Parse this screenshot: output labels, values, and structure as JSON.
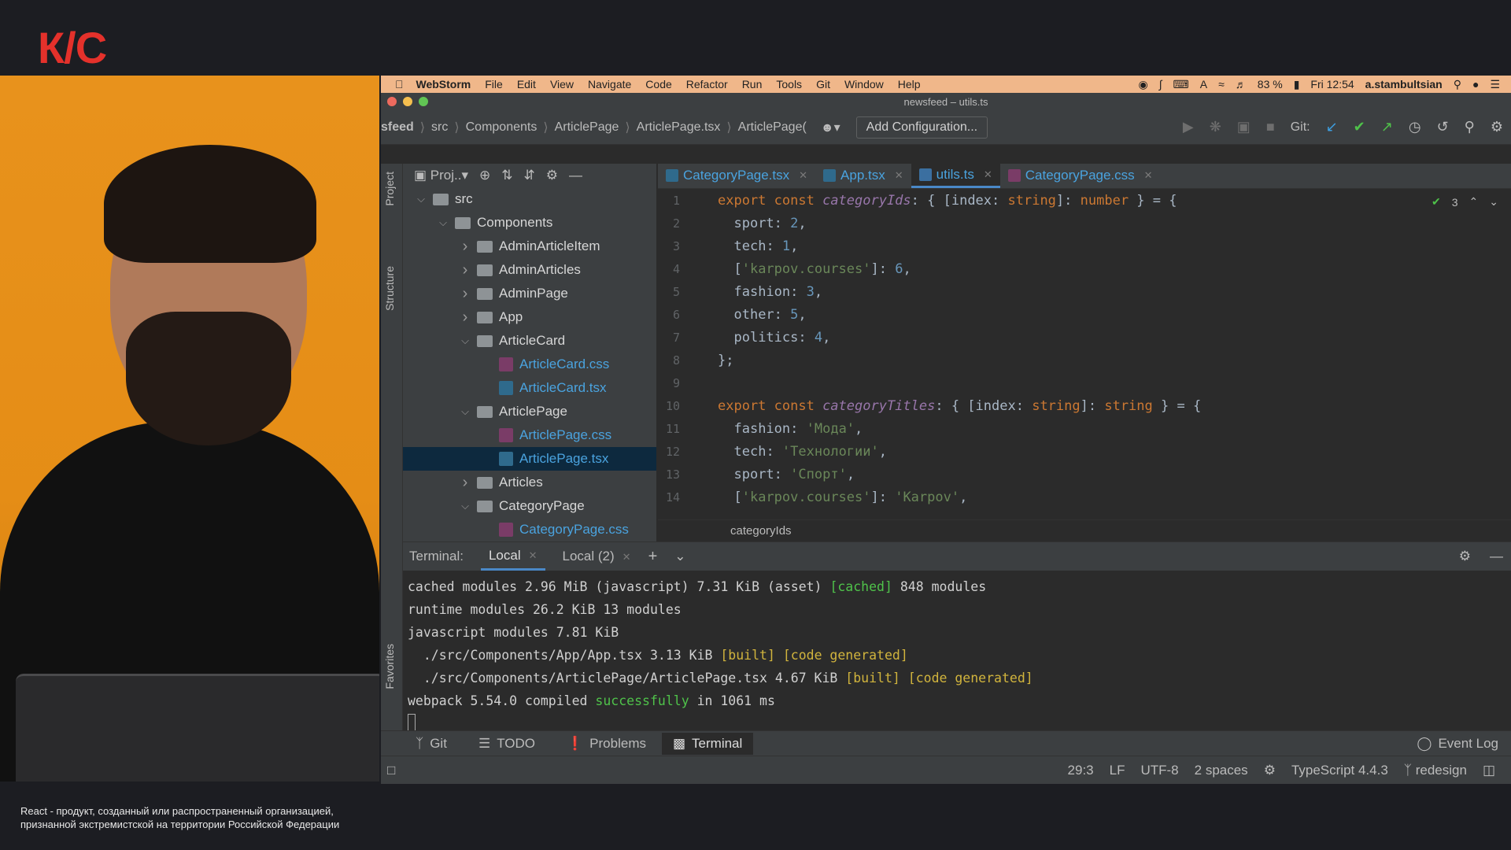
{
  "overlay": {
    "logo": "К/С",
    "disclaimer_line1": "React - продукт, созданный или распространенный организацией,",
    "disclaimer_line2": "признанной экстремистской на территории Российской Федерации"
  },
  "menubar": {
    "app": "WebStorm",
    "items": [
      "File",
      "Edit",
      "View",
      "Navigate",
      "Code",
      "Refactor",
      "Run",
      "Tools",
      "Git",
      "Window",
      "Help"
    ],
    "battery": "83 %",
    "clock": "Fri 12:54",
    "user": "a.stambultsian"
  },
  "window": {
    "title": "newsfeed – utils.ts"
  },
  "navbar": {
    "crumbs": [
      "sfeed",
      "src",
      "Components",
      "ArticlePage",
      "ArticlePage.tsx",
      "ArticlePage("
    ],
    "add_config": "Add Configuration...",
    "git_label": "Git:"
  },
  "side": {
    "project": "Project",
    "structure": "Structure",
    "favorites": "Favorites"
  },
  "project": {
    "header": "Proj..",
    "tree": [
      {
        "label": "src",
        "type": "folder",
        "level": 0,
        "open": true
      },
      {
        "label": "Components",
        "type": "folder",
        "level": 1,
        "open": true
      },
      {
        "label": "AdminArticleItem",
        "type": "folder",
        "level": 2,
        "open": false
      },
      {
        "label": "AdminArticles",
        "type": "folder",
        "level": 2,
        "open": false
      },
      {
        "label": "AdminPage",
        "type": "folder",
        "level": 2,
        "open": false
      },
      {
        "label": "App",
        "type": "folder",
        "level": 2,
        "open": false
      },
      {
        "label": "ArticleCard",
        "type": "folder",
        "level": 2,
        "open": true
      },
      {
        "label": "ArticleCard.css",
        "type": "css",
        "level": 3
      },
      {
        "label": "ArticleCard.tsx",
        "type": "tsx",
        "level": 3
      },
      {
        "label": "ArticlePage",
        "type": "folder",
        "level": 2,
        "open": true
      },
      {
        "label": "ArticlePage.css",
        "type": "css",
        "level": 3
      },
      {
        "label": "ArticlePage.tsx",
        "type": "tsx",
        "level": 3,
        "selected": true
      },
      {
        "label": "Articles",
        "type": "folder",
        "level": 2,
        "open": false
      },
      {
        "label": "CategoryPage",
        "type": "folder",
        "level": 2,
        "open": true
      },
      {
        "label": "CategoryPage.css",
        "type": "css",
        "level": 3
      }
    ]
  },
  "editor": {
    "tabs": [
      {
        "label": "CategoryPage.tsx",
        "kind": "tsx",
        "active": false
      },
      {
        "label": "App.tsx",
        "kind": "tsx",
        "active": false
      },
      {
        "label": "utils.ts",
        "kind": "ts",
        "active": true
      },
      {
        "label": "CategoryPage.css",
        "kind": "css",
        "active": false
      }
    ],
    "inspection_count": "3",
    "context": "categoryIds",
    "lines": [
      {
        "n": "1",
        "tokens": [
          [
            "kw",
            "export const "
          ],
          [
            "fn",
            "categoryIds"
          ],
          [
            "pl",
            ": { ["
          ],
          [
            "pl",
            "index: "
          ],
          [
            "kw",
            "string"
          ],
          [
            "pl",
            "]: "
          ],
          [
            "kw",
            "number"
          ],
          [
            "pl",
            " } = {"
          ]
        ]
      },
      {
        "n": "2",
        "tokens": [
          [
            "pl",
            "  "
          ],
          [
            "prop2",
            "sport"
          ],
          [
            "pl",
            ": "
          ],
          [
            "num",
            "2"
          ],
          [
            "pl",
            ","
          ]
        ]
      },
      {
        "n": "3",
        "tokens": [
          [
            "pl",
            "  "
          ],
          [
            "prop2",
            "tech"
          ],
          [
            "pl",
            ": "
          ],
          [
            "num",
            "1"
          ],
          [
            "pl",
            ","
          ]
        ]
      },
      {
        "n": "4",
        "tokens": [
          [
            "pl",
            "  ["
          ],
          [
            "str",
            "'karpov.courses'"
          ],
          [
            "pl",
            "]: "
          ],
          [
            "num",
            "6"
          ],
          [
            "pl",
            ","
          ]
        ]
      },
      {
        "n": "5",
        "tokens": [
          [
            "pl",
            "  "
          ],
          [
            "prop2",
            "fashion"
          ],
          [
            "pl",
            ": "
          ],
          [
            "num",
            "3"
          ],
          [
            "pl",
            ","
          ]
        ]
      },
      {
        "n": "6",
        "tokens": [
          [
            "pl",
            "  "
          ],
          [
            "prop2",
            "other"
          ],
          [
            "pl",
            ": "
          ],
          [
            "num",
            "5"
          ],
          [
            "pl",
            ","
          ]
        ]
      },
      {
        "n": "7",
        "tokens": [
          [
            "pl",
            "  "
          ],
          [
            "prop2",
            "politics"
          ],
          [
            "pl",
            ": "
          ],
          [
            "num",
            "4"
          ],
          [
            "pl",
            ","
          ]
        ]
      },
      {
        "n": "8",
        "tokens": [
          [
            "pl",
            "};"
          ]
        ]
      },
      {
        "n": "9",
        "tokens": []
      },
      {
        "n": "10",
        "tokens": [
          [
            "kw",
            "export const "
          ],
          [
            "fn",
            "categoryTitles"
          ],
          [
            "pl",
            ": { ["
          ],
          [
            "pl",
            "index: "
          ],
          [
            "kw",
            "string"
          ],
          [
            "pl",
            "]: "
          ],
          [
            "kw",
            "string"
          ],
          [
            "pl",
            " } = {"
          ]
        ]
      },
      {
        "n": "11",
        "tokens": [
          [
            "pl",
            "  "
          ],
          [
            "prop2",
            "fashion"
          ],
          [
            "pl",
            ": "
          ],
          [
            "str",
            "'Мода'"
          ],
          [
            "pl",
            ","
          ]
        ]
      },
      {
        "n": "12",
        "tokens": [
          [
            "pl",
            "  "
          ],
          [
            "prop2",
            "tech"
          ],
          [
            "pl",
            ": "
          ],
          [
            "str",
            "'Технологии'"
          ],
          [
            "pl",
            ","
          ]
        ]
      },
      {
        "n": "13",
        "tokens": [
          [
            "pl",
            "  "
          ],
          [
            "prop2",
            "sport"
          ],
          [
            "pl",
            ": "
          ],
          [
            "str",
            "'Спорт'"
          ],
          [
            "pl",
            ","
          ]
        ]
      },
      {
        "n": "14",
        "tokens": [
          [
            "pl",
            "  ["
          ],
          [
            "str",
            "'karpov.courses'"
          ],
          [
            "pl",
            "]: "
          ],
          [
            "str",
            "'Karpov'"
          ],
          [
            "pl",
            ","
          ]
        ]
      }
    ]
  },
  "terminal": {
    "label": "Terminal:",
    "tabs": [
      "Local",
      "Local (2)"
    ],
    "lines": [
      [
        [
          "d",
          "cached modules 2.96 MiB (javascript) 7.31 KiB (asset) "
        ],
        [
          "g",
          "[cached]"
        ],
        [
          "d",
          " 848 modules"
        ]
      ],
      [
        [
          "d",
          "runtime modules 26.2 KiB 13 modules"
        ]
      ],
      [
        [
          "d",
          "javascript modules 7.81 KiB"
        ]
      ],
      [
        [
          "d",
          "  ./src/Components/App/App.tsx 3.13 KiB "
        ],
        [
          "y",
          "[built] [code generated]"
        ]
      ],
      [
        [
          "d",
          "  ./src/Components/ArticlePage/ArticlePage.tsx 4.67 KiB "
        ],
        [
          "y",
          "[built] [code generated]"
        ]
      ],
      [
        [
          "d",
          "webpack 5.54.0 compiled "
        ],
        [
          "g",
          "successfully"
        ],
        [
          "d",
          " in 1061 ms"
        ]
      ]
    ]
  },
  "toolwindows": [
    "Git",
    "TODO",
    "Problems",
    "Terminal"
  ],
  "event_log": "Event Log",
  "status": {
    "position": "29:3",
    "line_sep": "LF",
    "encoding": "UTF-8",
    "indent": "2 spaces",
    "language": "TypeScript 4.4.3",
    "branch": "redesign"
  }
}
